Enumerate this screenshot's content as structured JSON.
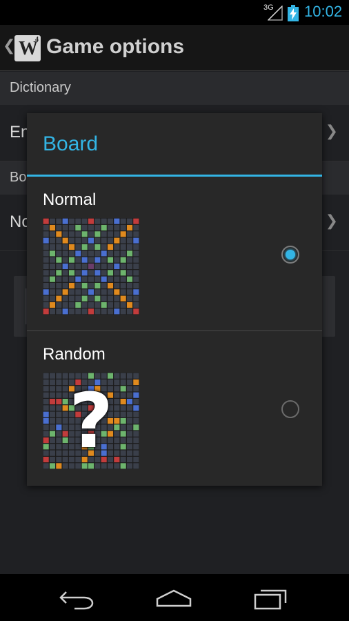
{
  "status_bar": {
    "network": "3G",
    "time": "10:02",
    "icons": [
      "signal-icon",
      "battery-charging-icon"
    ]
  },
  "action_bar": {
    "logo_letter": "W",
    "logo_sup": "4",
    "title": "Game options"
  },
  "background": {
    "dictionary_header": "Dictionary",
    "dictionary_value": "En",
    "board_header": "Bo",
    "board_value": "No",
    "chevron": "❯"
  },
  "dialog": {
    "title": "Board",
    "options": [
      {
        "label": "Normal",
        "selected": true,
        "icon": "normal-board-preview"
      },
      {
        "label": "Random",
        "selected": false,
        "icon": "random-board-preview",
        "overlay": "?"
      }
    ]
  },
  "nav_bar": {
    "icons": [
      "back-icon",
      "home-icon",
      "recent-apps-icon"
    ]
  },
  "colors": {
    "accent": "#33b5e5",
    "tile_blue": "#4a6fd0",
    "tile_orange": "#e08a1e",
    "tile_green": "#6db46d",
    "tile_red": "#c23c3c",
    "tile_purple": "#6a3d6a",
    "tile_empty": "#3a3f4a"
  }
}
